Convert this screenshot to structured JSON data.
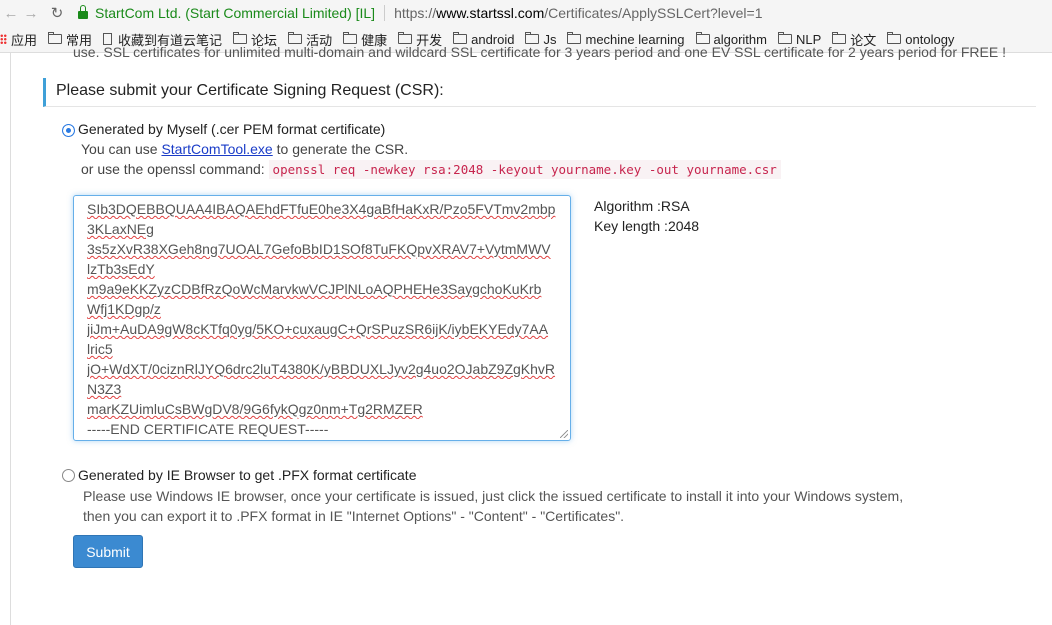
{
  "browser": {
    "org": "StartCom Ltd. (Start Commercial Limited) [IL]",
    "url_scheme": "https://",
    "url_domain": "www.startssl.com",
    "url_path": "/Certificates/ApplySSLCert?level=1"
  },
  "bookmarks": [
    {
      "label": "应用",
      "icon": "apps-icon"
    },
    {
      "label": "常用",
      "icon": "folder-icon"
    },
    {
      "label": "收藏到有道云笔记",
      "icon": "page-icon"
    },
    {
      "label": "论坛",
      "icon": "folder-icon"
    },
    {
      "label": "活动",
      "icon": "folder-icon"
    },
    {
      "label": "健康",
      "icon": "folder-icon"
    },
    {
      "label": "开发",
      "icon": "folder-icon"
    },
    {
      "label": "android",
      "icon": "folder-icon"
    },
    {
      "label": "Js",
      "icon": "folder-icon"
    },
    {
      "label": "mechine learning",
      "icon": "folder-icon"
    },
    {
      "label": "algorithm",
      "icon": "folder-icon"
    },
    {
      "label": "NLP",
      "icon": "folder-icon"
    },
    {
      "label": "论文",
      "icon": "folder-icon"
    },
    {
      "label": "ontology",
      "icon": "folder-icon"
    }
  ],
  "page": {
    "cut_text": "use. SSL certificates for unlimited multi-domain and wildcard SSL certificate for 3 years period and one EV SSL certificate for 2 years period for FREE !",
    "section_title": "Please submit your Certificate Signing Request (CSR):",
    "option1": {
      "label": "Generated by Myself   (.cer PEM format certificate)",
      "help1_prefix": "You can use ",
      "help1_link": "StartComTool.exe",
      "help1_suffix": " to generate the CSR.",
      "help2_prefix": "or use the openssl command:",
      "command": "openssl req -newkey rsa:2048 -keyout yourname.key -out yourname.csr"
    },
    "csr_lines": [
      "SIb3DQEBBQUAA4IBAQAEhdFTfuE0he3X4gaBfHaKxR/Pzo5FVTmv2mbp",
      "3KLaxNEg",
      "3s5zXvR38XGeh8ng7UOAL7GefoBbID1SOf8TuFKQpvXRAV7+VytmMWV",
      "lzTb3sEdY",
      "m9a9eKKZyzCDBfRzQoWcMarvkwVCJPlNLoAQPHEHe3SaygchoKuKrb",
      "Wfj1KDgp/z",
      "jiJm+AuDA9gW8cKTfq0yg/5KO+cuxaugC+QrSPuzSR6ijK/iybEKYEdy7AA",
      "lric5",
      "jO+WdXT/0ciznRlJYQ6drc2luT4380K/yBBDUXLJyv2g4uo2OJabZ9ZgKhvR",
      "N3Z3",
      "marKZUimluCsBWgDV8/9G6fykQgz0nm+Tg2RMZER",
      "-----END CERTIFICATE REQUEST-----"
    ],
    "algorithm": "Algorithm :RSA",
    "key_length": "Key length :2048",
    "option2": {
      "label": "Generated by IE Browser to get .PFX format certificate",
      "desc1": "Please use Windows IE browser, once your certificate is issued, just click the issued certificate to install it into your Windows system,",
      "desc2": "then you can export it to .PFX format in IE \"Internet Options\" - \"Content\" - \"Certificates\"."
    },
    "submit_label": "Submit"
  }
}
